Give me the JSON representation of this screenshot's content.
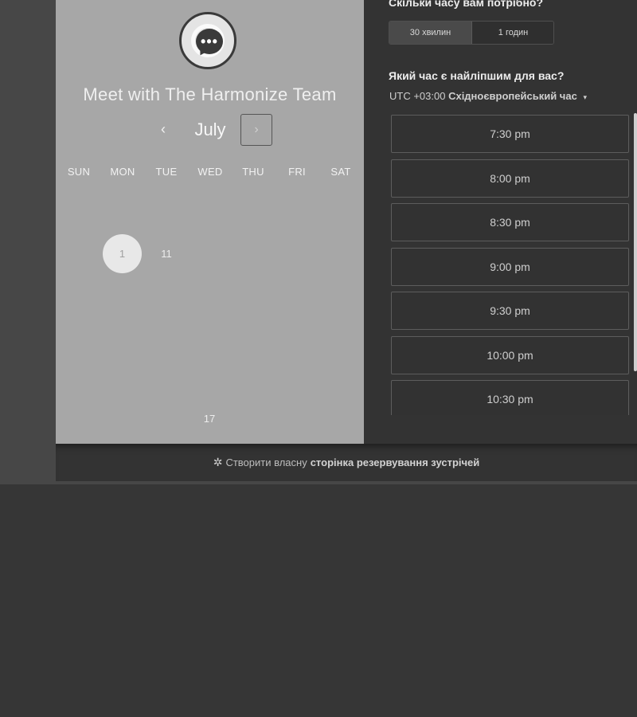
{
  "header": {
    "title": "Meet with The Harmonize Team",
    "avatar_glyph": "•••"
  },
  "calendar": {
    "month": "July",
    "prev_glyph": "‹",
    "next_glyph": "›",
    "weekdays": [
      "SUN",
      "MON",
      "TUE",
      "WED",
      "THU",
      "FRI",
      "SAT"
    ],
    "days": {
      "selected": "1",
      "second": "11",
      "bottom": "17"
    }
  },
  "booking": {
    "duration_question": "Скільки часу вам потрібно?",
    "durations": [
      "30 хвилин",
      "1 годин"
    ],
    "time_question": "Який час є найліпшим для вас?",
    "timezone_offset": "UTC +03:00",
    "timezone_name": "Східноєвропейський час",
    "timezone_caret": "▾",
    "slots": [
      "7:30 pm",
      "8:00 pm",
      "8:30 pm",
      "9:00 pm",
      "9:30 pm",
      "10:00 pm",
      "10:30 pm"
    ]
  },
  "footer": {
    "icon": "hubspot-sprocket-icon",
    "sprocket_glyph": "✲",
    "text": "Створити власну",
    "link": "сторінка резервування зустрічей"
  }
}
